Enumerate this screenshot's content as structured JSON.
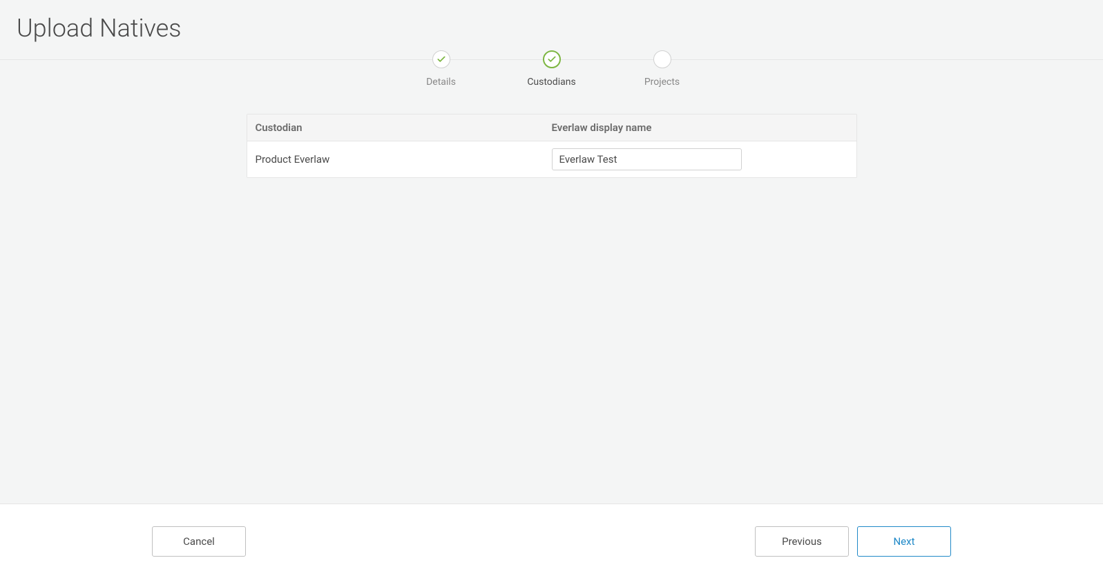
{
  "header": {
    "title": "Upload Natives"
  },
  "stepper": {
    "steps": [
      {
        "label": "Details"
      },
      {
        "label": "Custodians"
      },
      {
        "label": "Projects"
      }
    ]
  },
  "table": {
    "headers": {
      "custodian": "Custodian",
      "displayName": "Everlaw display name"
    },
    "rows": [
      {
        "custodian": "Product Everlaw",
        "displayName": "Everlaw Test"
      }
    ]
  },
  "footer": {
    "cancel": "Cancel",
    "previous": "Previous",
    "next": "Next"
  }
}
